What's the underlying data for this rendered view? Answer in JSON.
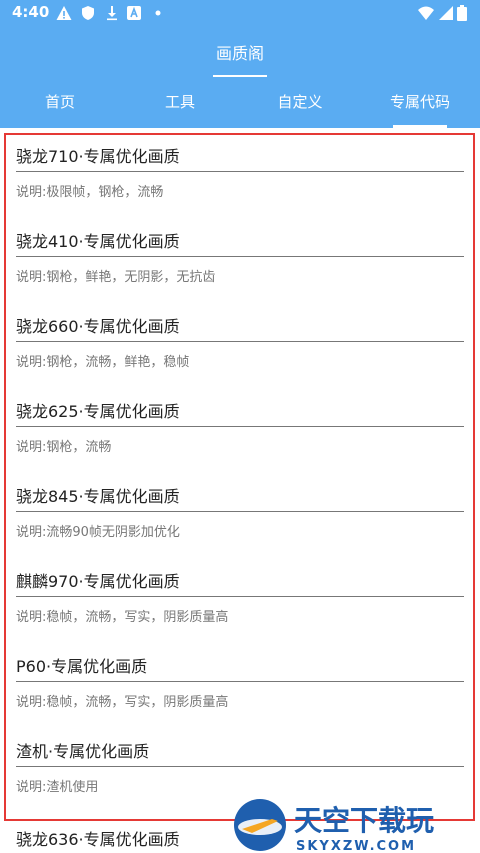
{
  "status_bar": {
    "time": "4:40",
    "icons": [
      "alert-icon",
      "shield-icon",
      "download-icon",
      "app-a-icon",
      "dot-icon",
      "wifi-icon",
      "signal-icon",
      "battery-icon"
    ]
  },
  "header": {
    "title": "画质阁"
  },
  "tabs": [
    {
      "label": "首页",
      "active": false
    },
    {
      "label": "工具",
      "active": false
    },
    {
      "label": "自定义",
      "active": false
    },
    {
      "label": "专属代码",
      "active": true
    }
  ],
  "items": [
    {
      "title": "骁龙710·专属优化画质",
      "desc": "说明:极限帧，钢枪，流畅"
    },
    {
      "title": "骁龙410·专属优化画质",
      "desc": "说明:钢枪，鲜艳，无阴影，无抗齿"
    },
    {
      "title": "骁龙660·专属优化画质",
      "desc": "说明:钢枪，流畅，鲜艳，稳帧"
    },
    {
      "title": "骁龙625·专属优化画质",
      "desc": "说明:钢枪，流畅"
    },
    {
      "title": "骁龙845·专属优化画质",
      "desc": "说明:流畅90帧无阴影加优化"
    },
    {
      "title": "麒麟970·专属优化画质",
      "desc": "说明:稳帧，流畅，写实，阴影质量高"
    },
    {
      "title": "P60·专属优化画质",
      "desc": "说明:稳帧，流畅，写实，阴影质量高"
    },
    {
      "title": "渣机·专属优化画质",
      "desc": "说明:渣机使用"
    },
    {
      "title": "骁龙636·专属优化画质"
    }
  ],
  "watermark": {
    "brand": "天空下载玩",
    "domain": "SKYXZW.COM"
  },
  "colors": {
    "header_bg": "#5aacf2",
    "highlight_border": "#e53935"
  }
}
